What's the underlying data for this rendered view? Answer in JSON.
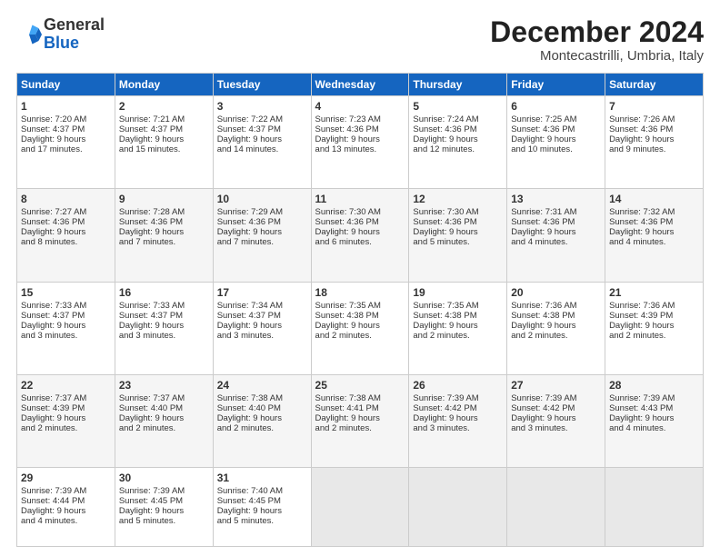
{
  "header": {
    "logo_general": "General",
    "logo_blue": "Blue",
    "title": "December 2024",
    "location": "Montecastrilli, Umbria, Italy"
  },
  "weekdays": [
    "Sunday",
    "Monday",
    "Tuesday",
    "Wednesday",
    "Thursday",
    "Friday",
    "Saturday"
  ],
  "weeks": [
    [
      {
        "day": "1",
        "lines": [
          "Sunrise: 7:20 AM",
          "Sunset: 4:37 PM",
          "Daylight: 9 hours",
          "and 17 minutes."
        ]
      },
      {
        "day": "2",
        "lines": [
          "Sunrise: 7:21 AM",
          "Sunset: 4:37 PM",
          "Daylight: 9 hours",
          "and 15 minutes."
        ]
      },
      {
        "day": "3",
        "lines": [
          "Sunrise: 7:22 AM",
          "Sunset: 4:37 PM",
          "Daylight: 9 hours",
          "and 14 minutes."
        ]
      },
      {
        "day": "4",
        "lines": [
          "Sunrise: 7:23 AM",
          "Sunset: 4:36 PM",
          "Daylight: 9 hours",
          "and 13 minutes."
        ]
      },
      {
        "day": "5",
        "lines": [
          "Sunrise: 7:24 AM",
          "Sunset: 4:36 PM",
          "Daylight: 9 hours",
          "and 12 minutes."
        ]
      },
      {
        "day": "6",
        "lines": [
          "Sunrise: 7:25 AM",
          "Sunset: 4:36 PM",
          "Daylight: 9 hours",
          "and 10 minutes."
        ]
      },
      {
        "day": "7",
        "lines": [
          "Sunrise: 7:26 AM",
          "Sunset: 4:36 PM",
          "Daylight: 9 hours",
          "and 9 minutes."
        ]
      }
    ],
    [
      {
        "day": "8",
        "lines": [
          "Sunrise: 7:27 AM",
          "Sunset: 4:36 PM",
          "Daylight: 9 hours",
          "and 8 minutes."
        ]
      },
      {
        "day": "9",
        "lines": [
          "Sunrise: 7:28 AM",
          "Sunset: 4:36 PM",
          "Daylight: 9 hours",
          "and 7 minutes."
        ]
      },
      {
        "day": "10",
        "lines": [
          "Sunrise: 7:29 AM",
          "Sunset: 4:36 PM",
          "Daylight: 9 hours",
          "and 7 minutes."
        ]
      },
      {
        "day": "11",
        "lines": [
          "Sunrise: 7:30 AM",
          "Sunset: 4:36 PM",
          "Daylight: 9 hours",
          "and 6 minutes."
        ]
      },
      {
        "day": "12",
        "lines": [
          "Sunrise: 7:30 AM",
          "Sunset: 4:36 PM",
          "Daylight: 9 hours",
          "and 5 minutes."
        ]
      },
      {
        "day": "13",
        "lines": [
          "Sunrise: 7:31 AM",
          "Sunset: 4:36 PM",
          "Daylight: 9 hours",
          "and 4 minutes."
        ]
      },
      {
        "day": "14",
        "lines": [
          "Sunrise: 7:32 AM",
          "Sunset: 4:36 PM",
          "Daylight: 9 hours",
          "and 4 minutes."
        ]
      }
    ],
    [
      {
        "day": "15",
        "lines": [
          "Sunrise: 7:33 AM",
          "Sunset: 4:37 PM",
          "Daylight: 9 hours",
          "and 3 minutes."
        ]
      },
      {
        "day": "16",
        "lines": [
          "Sunrise: 7:33 AM",
          "Sunset: 4:37 PM",
          "Daylight: 9 hours",
          "and 3 minutes."
        ]
      },
      {
        "day": "17",
        "lines": [
          "Sunrise: 7:34 AM",
          "Sunset: 4:37 PM",
          "Daylight: 9 hours",
          "and 3 minutes."
        ]
      },
      {
        "day": "18",
        "lines": [
          "Sunrise: 7:35 AM",
          "Sunset: 4:38 PM",
          "Daylight: 9 hours",
          "and 2 minutes."
        ]
      },
      {
        "day": "19",
        "lines": [
          "Sunrise: 7:35 AM",
          "Sunset: 4:38 PM",
          "Daylight: 9 hours",
          "and 2 minutes."
        ]
      },
      {
        "day": "20",
        "lines": [
          "Sunrise: 7:36 AM",
          "Sunset: 4:38 PM",
          "Daylight: 9 hours",
          "and 2 minutes."
        ]
      },
      {
        "day": "21",
        "lines": [
          "Sunrise: 7:36 AM",
          "Sunset: 4:39 PM",
          "Daylight: 9 hours",
          "and 2 minutes."
        ]
      }
    ],
    [
      {
        "day": "22",
        "lines": [
          "Sunrise: 7:37 AM",
          "Sunset: 4:39 PM",
          "Daylight: 9 hours",
          "and 2 minutes."
        ]
      },
      {
        "day": "23",
        "lines": [
          "Sunrise: 7:37 AM",
          "Sunset: 4:40 PM",
          "Daylight: 9 hours",
          "and 2 minutes."
        ]
      },
      {
        "day": "24",
        "lines": [
          "Sunrise: 7:38 AM",
          "Sunset: 4:40 PM",
          "Daylight: 9 hours",
          "and 2 minutes."
        ]
      },
      {
        "day": "25",
        "lines": [
          "Sunrise: 7:38 AM",
          "Sunset: 4:41 PM",
          "Daylight: 9 hours",
          "and 2 minutes."
        ]
      },
      {
        "day": "26",
        "lines": [
          "Sunrise: 7:39 AM",
          "Sunset: 4:42 PM",
          "Daylight: 9 hours",
          "and 3 minutes."
        ]
      },
      {
        "day": "27",
        "lines": [
          "Sunrise: 7:39 AM",
          "Sunset: 4:42 PM",
          "Daylight: 9 hours",
          "and 3 minutes."
        ]
      },
      {
        "day": "28",
        "lines": [
          "Sunrise: 7:39 AM",
          "Sunset: 4:43 PM",
          "Daylight: 9 hours",
          "and 4 minutes."
        ]
      }
    ],
    [
      {
        "day": "29",
        "lines": [
          "Sunrise: 7:39 AM",
          "Sunset: 4:44 PM",
          "Daylight: 9 hours",
          "and 4 minutes."
        ]
      },
      {
        "day": "30",
        "lines": [
          "Sunrise: 7:39 AM",
          "Sunset: 4:45 PM",
          "Daylight: 9 hours",
          "and 5 minutes."
        ]
      },
      {
        "day": "31",
        "lines": [
          "Sunrise: 7:40 AM",
          "Sunset: 4:45 PM",
          "Daylight: 9 hours",
          "and 5 minutes."
        ]
      },
      null,
      null,
      null,
      null
    ]
  ]
}
